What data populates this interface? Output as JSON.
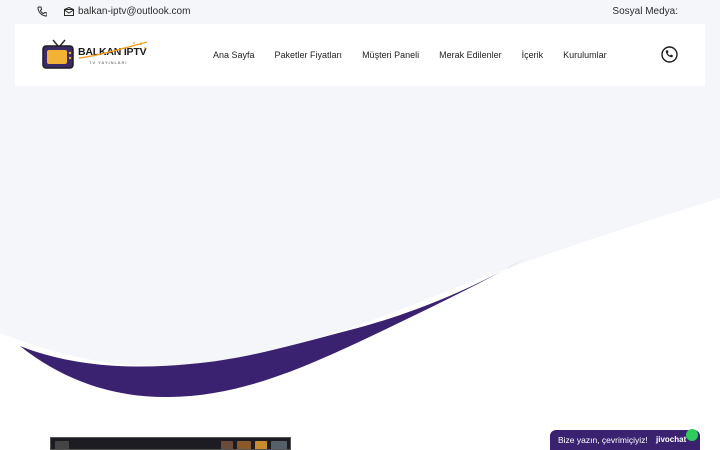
{
  "topbar": {
    "email": "balkan-iptv@outlook.com",
    "social_label": "Sosyal Medya:"
  },
  "logo": {
    "title": "BALKAN IPTV",
    "subtitle": "TV YAYINLARI"
  },
  "nav": {
    "items": [
      {
        "label": "Ana Sayfa"
      },
      {
        "label": "Paketler Fiyatları"
      },
      {
        "label": "Müşteri Paneli"
      },
      {
        "label": "Merak Edilenler"
      },
      {
        "label": "İçerik"
      },
      {
        "label": "Kurulumlar"
      }
    ]
  },
  "chat": {
    "label": "Bize yazın, çevrimiçiyiz!",
    "brand": "jivochat"
  },
  "colors": {
    "hero_background": "#f5f6fa",
    "wave": "#3b2270",
    "chat_online": "#2ecc5a"
  },
  "icons": {
    "topbar_phone": "phone-icon",
    "topbar_mail": "mail-icon",
    "header_call": "phone-circle-icon"
  }
}
